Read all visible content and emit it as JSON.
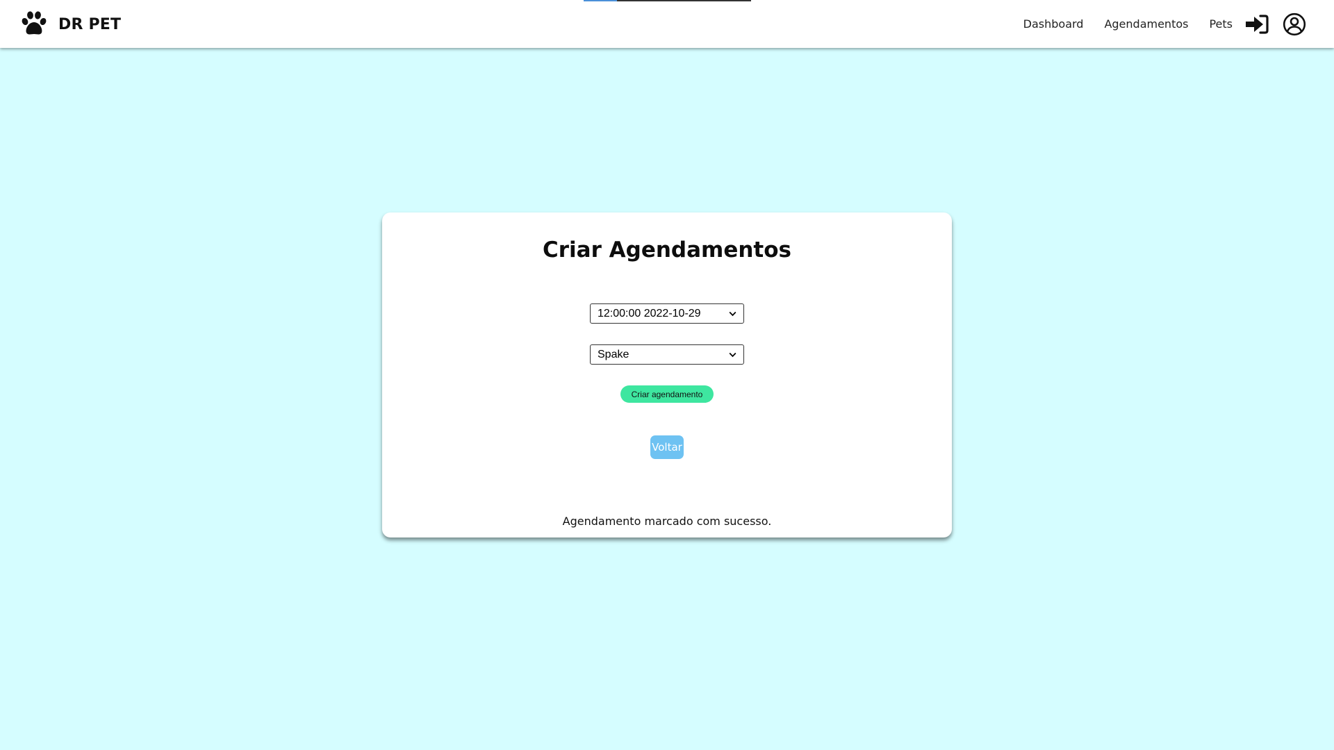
{
  "header": {
    "brand": "DR PET",
    "logo_icon": "paw-icon",
    "nav": [
      {
        "label": "Dashboard"
      },
      {
        "label": "Agendamentos"
      },
      {
        "label": "Pets"
      }
    ],
    "login_icon": "sign-in-icon",
    "user_icon": "user-circle-icon",
    "loading_progress": 0.2
  },
  "form": {
    "title": "Criar Agendamentos",
    "schedule_select_value": "12:00:00 2022-10-29",
    "pet_select_value": "Spake",
    "create_button": "Criar agendamento",
    "back_button": "Voltar",
    "status_message": "Agendamento marcado com sucesso."
  },
  "colors": {
    "page_background": "#d5fdff",
    "create_button": "#3ee6a0",
    "back_button": "#6ec2f2",
    "loader_accent": "#4a90d9"
  }
}
